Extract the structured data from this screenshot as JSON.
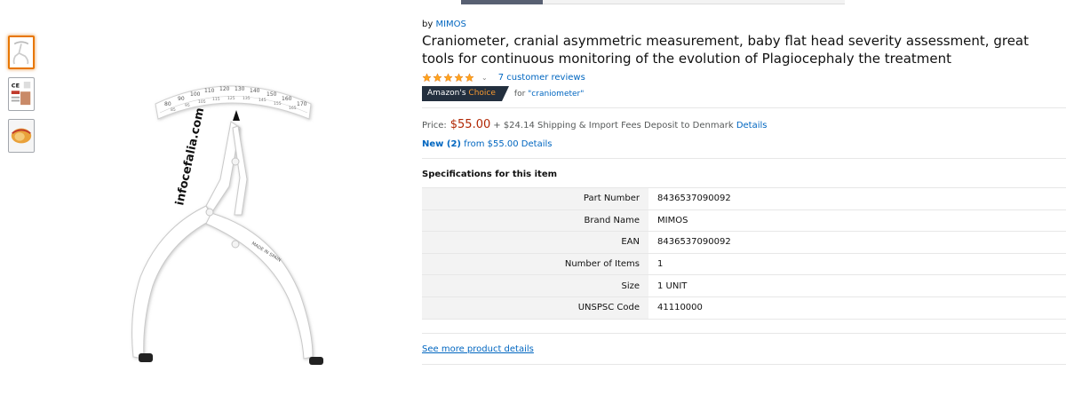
{
  "brand": {
    "prefix": "by",
    "name": "MIMOS"
  },
  "product": {
    "title": "Craniometer, cranial asymmetric measurement, baby flat head severity assessment, great tools for continuous monitoring of the evolution of Plagiocephaly the treatment"
  },
  "rating": {
    "stars": 5,
    "reviews_label": "7 customer reviews"
  },
  "badge": {
    "amazons": "Amazon's",
    "choice": "Choice",
    "for_prefix": "for",
    "keyword": "\"craniometer\""
  },
  "price": {
    "label": "Price:",
    "value": "$55.00",
    "shipping": "+ $24.14 Shipping & Import Fees Deposit to Denmark",
    "details_link": "Details"
  },
  "offers": {
    "new_label": "New (2)",
    "from_text": "from $55.00 Details"
  },
  "specs": {
    "heading": "Specifications for this item",
    "rows": [
      {
        "label": "Part Number",
        "value": "8436537090092"
      },
      {
        "label": "Brand Name",
        "value": "MIMOS"
      },
      {
        "label": "EAN",
        "value": "8436537090092"
      },
      {
        "label": "Number of Items",
        "value": "1"
      },
      {
        "label": "Size",
        "value": "1 UNIT"
      },
      {
        "label": "UNSPSC Code",
        "value": "41110000"
      }
    ]
  },
  "see_more": "See more product details",
  "image_text": {
    "brand_text": "infocefalia.com",
    "made_in": "MADE IN SPAIN",
    "scale_outer": [
      "80",
      "90",
      "100",
      "110",
      "120",
      "130",
      "140",
      "150",
      "160",
      "170"
    ],
    "scale_inner": [
      "85",
      "95",
      "105",
      "115",
      "125",
      "135",
      "145",
      "155",
      "165"
    ],
    "ce_mark": "CE"
  },
  "colors": {
    "link": "#0066c0",
    "price": "#b12704",
    "star": "#ffa41c",
    "badge_bg": "#232f3e",
    "badge_accent": "#f69931",
    "thumb_selected": "#e77600"
  }
}
